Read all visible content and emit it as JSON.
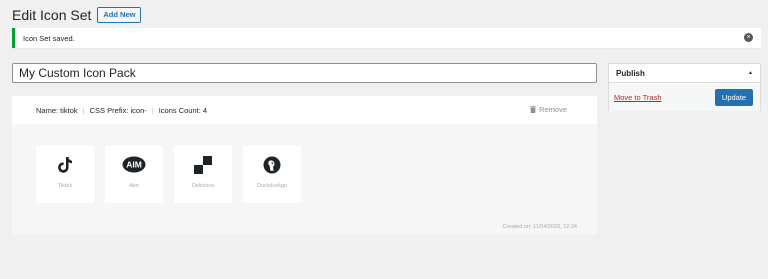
{
  "header": {
    "title": "Edit Icon Set",
    "add_new_label": "Add New"
  },
  "notice": {
    "text": "Icon Set saved.",
    "dismiss_icon": "dismiss-icon"
  },
  "title_field": {
    "value": "My Custom Icon Pack"
  },
  "publish": {
    "title": "Publish",
    "toggle_icon": "▲",
    "trash_label": "Move to Trash",
    "update_label": "Update"
  },
  "icon_set": {
    "name_label": "Name: tiktok",
    "prefix_label": "CSS Prefix: icon-",
    "count_label": "Icons Count: 4",
    "remove_label": "Remove",
    "icons": [
      {
        "label": "Tiktok",
        "icon": "tiktok-icon"
      },
      {
        "label": "Aim",
        "icon": "aim-icon"
      },
      {
        "label": "Delicious",
        "icon": "delicious-icon"
      },
      {
        "label": "Duckduckgo",
        "icon": "duckduckgo-icon"
      }
    ],
    "created_on": "Created on: 11/04/2020, 12:34"
  },
  "colors": {
    "accent": "#2271b1",
    "success": "#00a32a",
    "danger": "#b32d2e"
  }
}
